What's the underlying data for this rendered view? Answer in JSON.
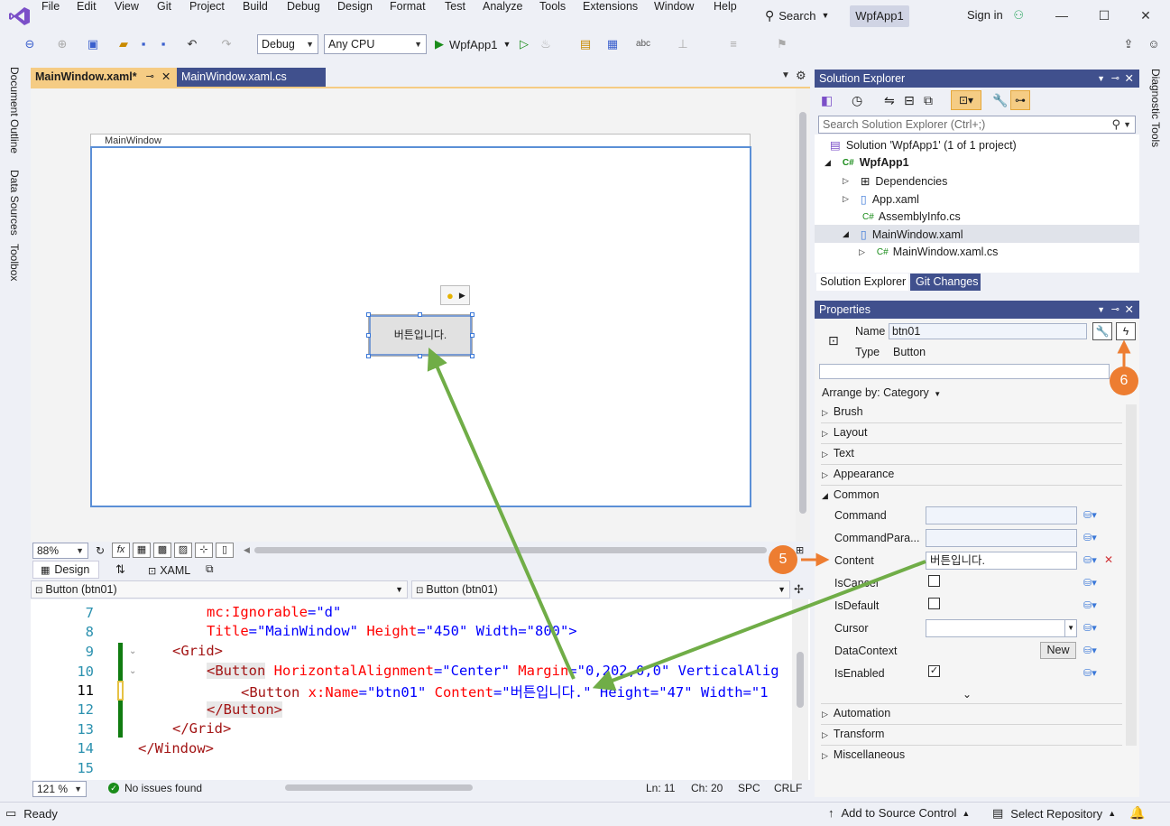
{
  "menu": {
    "items": [
      "File",
      "Edit",
      "View",
      "Git",
      "Project",
      "Build",
      "Debug",
      "Design",
      "Format",
      "Test",
      "Analyze",
      "Tools",
      "Extensions",
      "Window",
      "Help"
    ],
    "search_label": "Search",
    "title_badge": "WpfApp1",
    "sign_in": "Sign in"
  },
  "toolbar": {
    "config": "Debug",
    "platform": "Any CPU",
    "run_target": "WpfApp1"
  },
  "left_strip": {
    "tabs": [
      "Document Outline",
      "Data Sources",
      "Toolbox"
    ]
  },
  "right_strip": {
    "tab": "Diagnostic Tools"
  },
  "doc_tabs": {
    "active": "MainWindow.xaml*",
    "other": "MainWindow.xaml.cs"
  },
  "designer": {
    "window_title": "MainWindow",
    "button_text": "버튼입니다.",
    "zoom": "88%",
    "design_tab": "Design",
    "xaml_tab": "XAML",
    "fx_label": "fx"
  },
  "navbar": {
    "left": "Button (btn01)",
    "right": "Button (btn01)"
  },
  "code": {
    "line_numbers": [
      "7",
      "8",
      "9",
      "10",
      "11",
      "12",
      "13",
      "14",
      "15"
    ],
    "lines": [
      {
        "p1": "mc",
        "p2": ":Ignorable",
        "p3": "=\"d\"",
        "p4": "",
        "p5": ""
      },
      {
        "p1": "Title",
        "p2": "=\"MainWindow\"",
        "p3": " Height",
        "p4": "=\"450\"",
        "p5": " Width=\"800\">"
      },
      {
        "p1": "<Grid>"
      },
      {
        "p1": "<Button",
        "p2": " HorizontalAlignment",
        "p3": "=\"Center\"",
        "p4": " Margin",
        "p5": "=\"0,202,0,0\" VerticalAlig"
      },
      {
        "p1": "<Button",
        "p2": " x:Name",
        "p3": "=\"btn01\"",
        "p4": " Content",
        "p5": "=\"버튼입니다.\" Height=\"47\" Width=\"1"
      },
      {
        "p1": "</Button>"
      },
      {
        "p1": "</Grid>"
      },
      {
        "p1": "</Window>"
      }
    ]
  },
  "editor_status": {
    "zoom": "121 %",
    "issues": "No issues found",
    "ln": "Ln: 11",
    "ch": "Ch: 20",
    "spc": "SPC",
    "crlf": "CRLF"
  },
  "solution_explorer": {
    "title": "Solution Explorer",
    "search_placeholder": "Search Solution Explorer (Ctrl+;)",
    "items": [
      {
        "label": "Solution 'WpfApp1' (1 of 1 project)"
      },
      {
        "label": "WpfApp1"
      },
      {
        "label": "Dependencies"
      },
      {
        "label": "App.xaml"
      },
      {
        "label": "AssemblyInfo.cs"
      },
      {
        "label": "MainWindow.xaml"
      },
      {
        "label": "MainWindow.xaml.cs"
      }
    ],
    "tabs": [
      "Solution Explorer",
      "Git Changes"
    ]
  },
  "properties": {
    "title": "Properties",
    "name_label": "Name",
    "name_value": "btn01",
    "type_label": "Type",
    "type_value": "Button",
    "arrange_by": "Arrange by: Category",
    "categories": [
      "Brush",
      "Layout",
      "Text",
      "Appearance",
      "Common",
      "Automation",
      "Transform",
      "Miscellaneous"
    ],
    "common_props": [
      "Command",
      "CommandPara...",
      "Content",
      "IsCancel",
      "IsDefault",
      "Cursor",
      "DataContext",
      "IsEnabled"
    ],
    "content_value": "버튼입니다.",
    "new_button": "New",
    "check_mark": "✓"
  },
  "callouts": {
    "five": "5",
    "six": "6"
  },
  "status": {
    "ready": "Ready",
    "source_control": "Add to Source Control",
    "repository": "Select Repository"
  },
  "colors": {
    "accent": "#40508d",
    "active_tab": "#f5cc84",
    "arrow_green": "#70ad47",
    "callout_orange": "#ed7d31"
  }
}
